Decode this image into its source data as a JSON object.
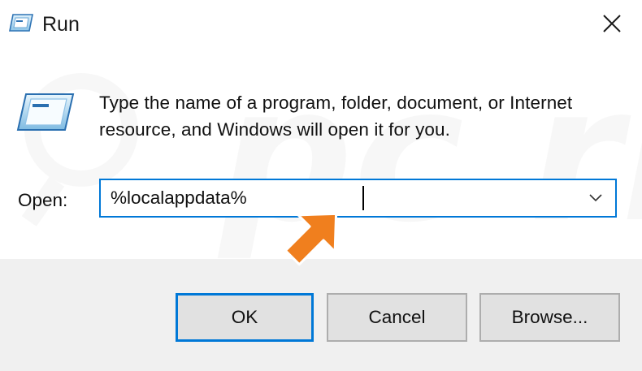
{
  "window": {
    "title": "Run",
    "close_symbol": "✕"
  },
  "content": {
    "description": "Type the name of a program, folder, document, or Internet resource, and Windows will open it for you."
  },
  "open_field": {
    "label": "Open:",
    "value": "%localappdata%"
  },
  "buttons": {
    "ok": "OK",
    "cancel": "Cancel",
    "browse": "Browse..."
  },
  "watermark": {
    "text": "pc risk.com"
  },
  "colors": {
    "accent": "#0078d7",
    "footer": "#f0f0f0",
    "button": "#e1e1e1",
    "pointer_arrow": "#f07f1e"
  },
  "icons": {
    "title": "run-app-icon",
    "main": "run-program-icon",
    "dropdown": "chevron-down-icon",
    "close": "close-icon",
    "annotation": "orange-arrow-pointer"
  }
}
